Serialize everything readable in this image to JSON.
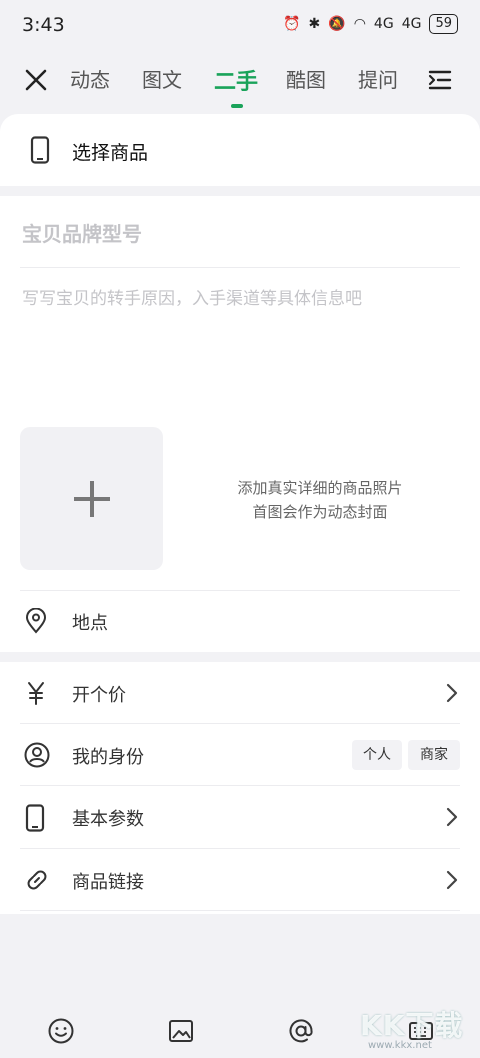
{
  "status": {
    "time": "3:43",
    "signal1": "4G",
    "signal2": "4G",
    "battery": "59"
  },
  "nav": {
    "tabs": [
      {
        "label": "动态"
      },
      {
        "label": "图文"
      },
      {
        "label": "二手",
        "active": true
      },
      {
        "label": "酷图"
      },
      {
        "label": "提问"
      }
    ]
  },
  "form": {
    "select_product": "选择商品",
    "title_placeholder": "宝贝品牌型号",
    "desc_placeholder": "写写宝贝的转手原因，入手渠道等具体信息吧",
    "photo_hint_line1": "添加真实详细的商品照片",
    "photo_hint_line2": "首图会作为动态封面",
    "location": "地点"
  },
  "options": {
    "price": "开个价",
    "identity": "我的身份",
    "identity_options": [
      "个人",
      "商家"
    ],
    "params": "基本参数",
    "link": "商品链接"
  },
  "watermark": {
    "brand": "KK下载",
    "site": "www.kkx.net"
  },
  "colors": {
    "accent": "#1aa35a",
    "background": "#f2f2f5",
    "card": "#ffffff"
  },
  "icons": [
    "close-icon",
    "menu-indent-icon",
    "phone-icon",
    "plus-icon",
    "location-pin-icon",
    "yuan-icon",
    "user-circle-icon",
    "link-icon",
    "chevron-right-icon",
    "emoji-icon",
    "image-icon",
    "at-icon",
    "keyboard-icon"
  ]
}
